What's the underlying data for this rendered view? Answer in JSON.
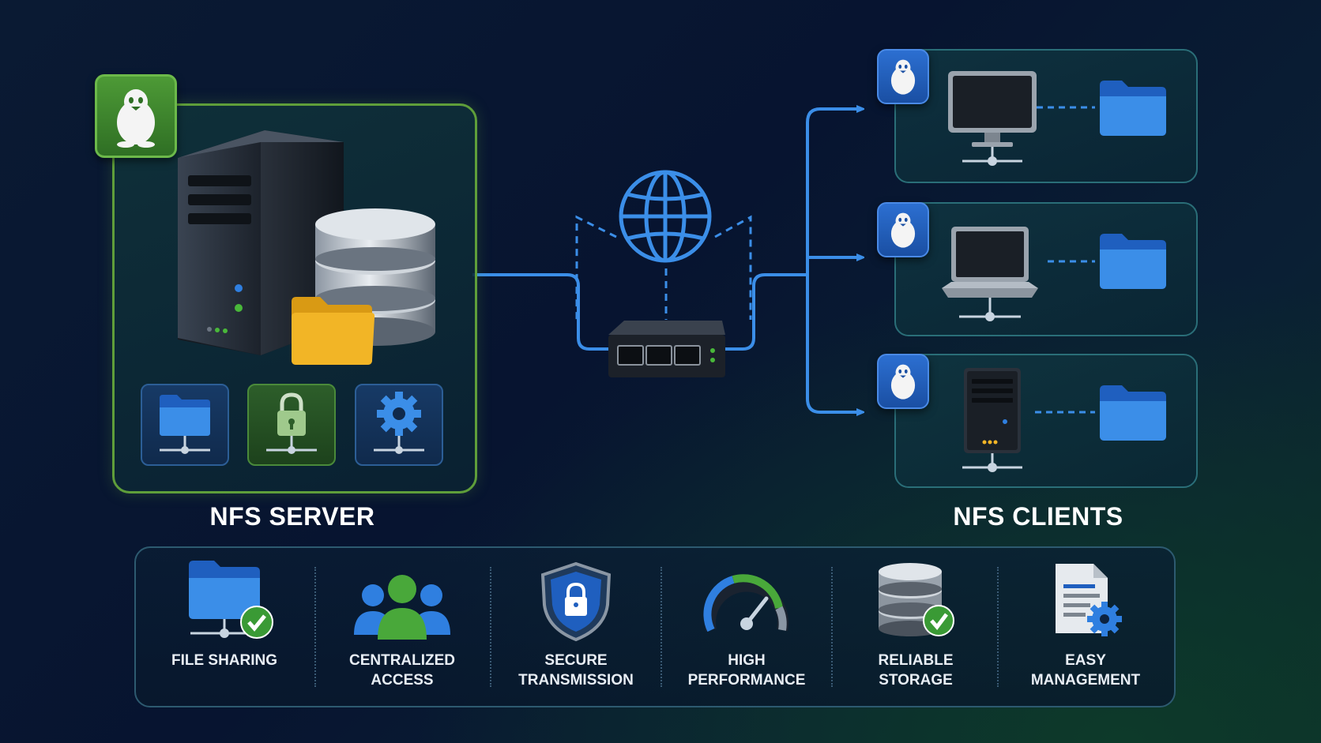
{
  "server": {
    "label": "NFS SERVER",
    "badge_icon": "linux-penguin-icon",
    "tiles": [
      {
        "icon": "network-folder-icon"
      },
      {
        "icon": "network-lock-icon"
      },
      {
        "icon": "network-gear-icon"
      }
    ]
  },
  "network": {
    "globe_icon": "globe-icon",
    "switch_icon": "network-switch-icon"
  },
  "clients": {
    "label": "NFS CLIENTS",
    "items": [
      {
        "device": "desktop-monitor-icon",
        "folder": "folder-icon"
      },
      {
        "device": "laptop-icon",
        "folder": "folder-icon"
      },
      {
        "device": "tower-server-icon",
        "folder": "folder-icon"
      }
    ]
  },
  "features": [
    {
      "label": "FILE SHARING",
      "icon": "shared-folder-check-icon"
    },
    {
      "label": "CENTRALIZED\nACCESS",
      "icon": "users-group-icon"
    },
    {
      "label": "SECURE\nTRANSMISSION",
      "icon": "shield-lock-icon"
    },
    {
      "label": "HIGH\nPERFORMANCE",
      "icon": "speedometer-icon"
    },
    {
      "label": "RELIABLE\nSTORAGE",
      "icon": "database-check-icon"
    },
    {
      "label": "EASY\nMANAGEMENT",
      "icon": "document-gear-icon"
    }
  ],
  "colors": {
    "accent_blue": "#3b8ee8",
    "accent_green": "#5f9e3a",
    "folder_blue": "#2f7fe0",
    "folder_yellow": "#f2b526"
  }
}
